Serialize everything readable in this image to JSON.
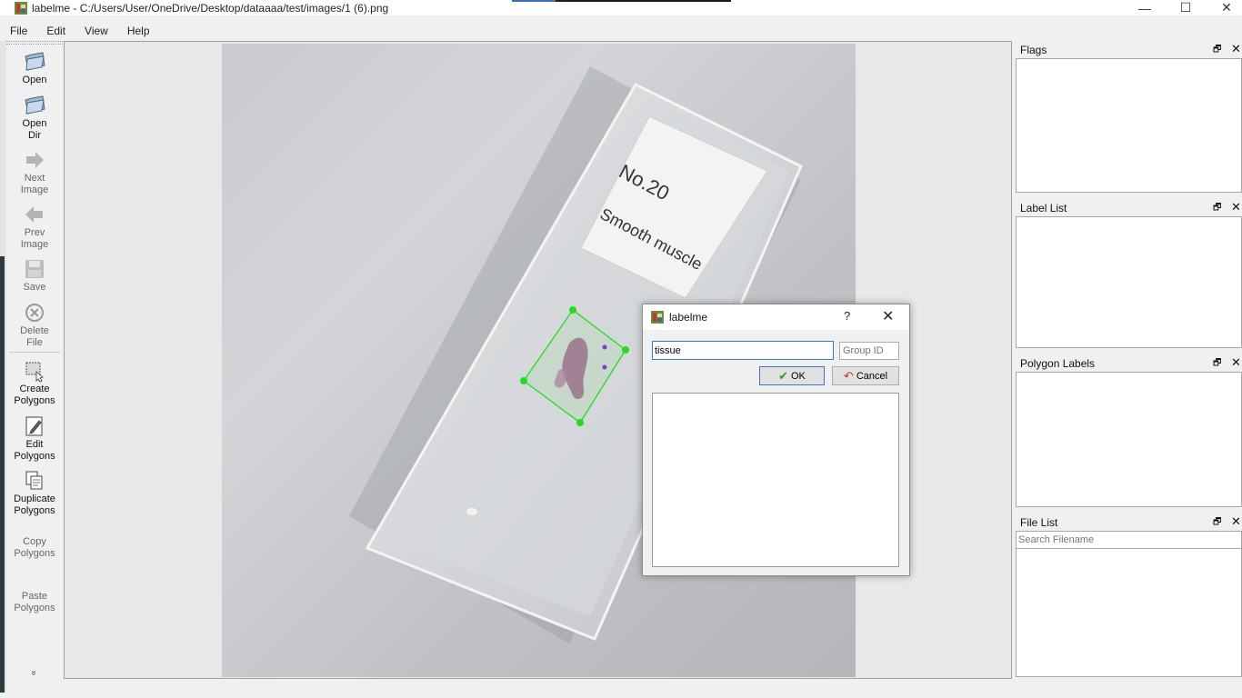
{
  "window": {
    "title": "labelme - C:/Users/User/OneDrive/Desktop/dataaaa/test/images/1 (6).png",
    "minimize": "—",
    "maximize": "☐",
    "close": "✕"
  },
  "menu": [
    "File",
    "Edit",
    "View",
    "Help"
  ],
  "toolbar": {
    "open": "Open",
    "open_dir": [
      "Open",
      "Dir"
    ],
    "next_image": [
      "Next",
      "Image"
    ],
    "prev_image": [
      "Prev",
      "Image"
    ],
    "save": "Save",
    "delete_file": [
      "Delete",
      "File"
    ],
    "create_polygons": [
      "Create",
      "Polygons"
    ],
    "edit_polygons": [
      "Edit",
      "Polygons"
    ],
    "duplicate_polygons": [
      "Duplicate",
      "Polygons"
    ],
    "copy_polygons": [
      "Copy",
      "Polygons"
    ],
    "paste_polygons": [
      "Paste",
      "Polygons"
    ],
    "more": "»"
  },
  "image": {
    "slide_text_1": "No.20",
    "slide_text_2": "Smooth muscle"
  },
  "docks": {
    "flags": "Flags",
    "label_list": "Label List",
    "polygon_labels": "Polygon Labels",
    "file_list": "File List",
    "search_placeholder": "Search Filename",
    "float_icon": "🗗",
    "close_icon": "✕"
  },
  "dialog": {
    "title": "labelme",
    "help": "?",
    "close": "✕",
    "label_value": "tissue",
    "group_id_placeholder": "Group ID",
    "ok": "OK",
    "cancel": "Cancel"
  },
  "colors": {
    "polygon": "#22dd22",
    "accent": "#3a78c8"
  }
}
